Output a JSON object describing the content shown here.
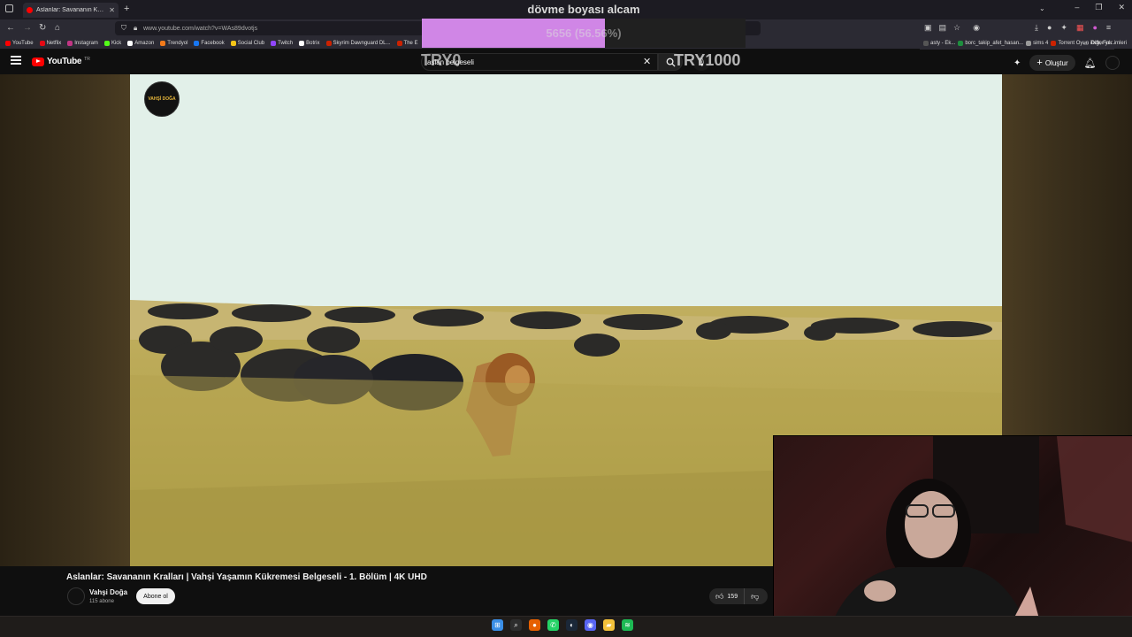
{
  "browser": {
    "tab_title": "Aslanlar: Savananın Kralları | Va",
    "url": "www.youtube.com/watch?v=WAs89dvotjs",
    "bookmarks": [
      {
        "label": "YouTube",
        "color": "#ff0000"
      },
      {
        "label": "Netflix",
        "color": "#e50914"
      },
      {
        "label": "Instagram",
        "color": "#c13584"
      },
      {
        "label": "Kick",
        "color": "#53fc18"
      },
      {
        "label": "Amazon",
        "color": "#ffffff"
      },
      {
        "label": "Trendyol",
        "color": "#f27a1a"
      },
      {
        "label": "Facebook",
        "color": "#1877f2"
      },
      {
        "label": "Social Club",
        "color": "#f5c518"
      },
      {
        "label": "Twitch",
        "color": "#9146ff"
      },
      {
        "label": "Botrix",
        "color": "#ffffff"
      },
      {
        "label": "Skyrim Dawnguard DL...",
        "color": "#cc2200"
      },
      {
        "label": "The E",
        "color": "#cc2200"
      }
    ],
    "bookmarks_right": [
      {
        "label": "asty - Ek...",
        "color": "#555555"
      },
      {
        "label": "borc_takip_afet_hasan...",
        "color": "#1e8e3e"
      },
      {
        "label": "sims 4",
        "color": "#999999"
      },
      {
        "label": "Torrent Oyun indir, Ful...",
        "color": "#cc2200"
      }
    ],
    "other_bookmarks": "Diğer yer imleri"
  },
  "overlay": {
    "goal_title": "dövme boyası alcam",
    "goal_progress_text": "5656 (56.56%)",
    "goal_progress": 0.5656,
    "goal_left": "TRY0",
    "goal_right": "TRY1000",
    "fill_color": "#d086e6"
  },
  "youtube": {
    "logo": "YouTube",
    "logo_region": "TR",
    "search_value": "aslan belgeseli",
    "create_label": "Oluştur"
  },
  "video": {
    "watermark": "VAHŞİ DOĞA",
    "title": "Aslanlar: Savananın Kralları | Vahşi Yaşamın Kükremesi Belgeseli - 1. Bölüm | 4K UHD",
    "channel_name": "Vahşi Doğa",
    "subscribers": "115 abone",
    "subscribe_label": "Abone ol",
    "likes": "159"
  },
  "taskbar": {
    "icons": [
      "windows-start-icon",
      "search-icon",
      "firefox-icon",
      "whatsapp-icon",
      "steam-icon",
      "discord-icon",
      "file-explorer-icon",
      "spotify-icon"
    ]
  }
}
